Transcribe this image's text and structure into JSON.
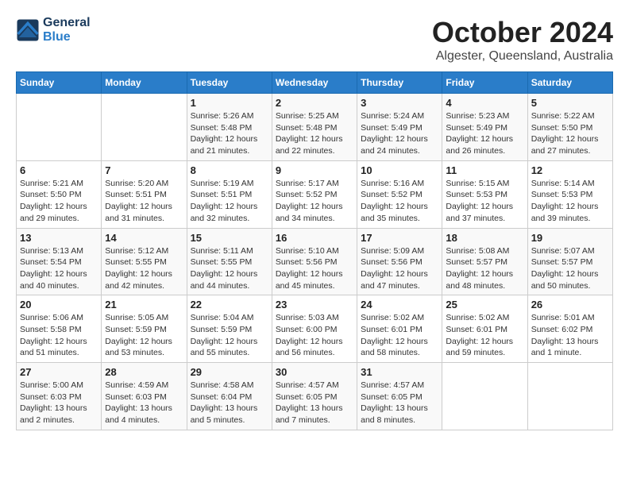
{
  "header": {
    "logo_line1": "General",
    "logo_line2": "Blue",
    "month": "October 2024",
    "location": "Algester, Queensland, Australia"
  },
  "days_of_week": [
    "Sunday",
    "Monday",
    "Tuesday",
    "Wednesday",
    "Thursday",
    "Friday",
    "Saturday"
  ],
  "weeks": [
    [
      {
        "day": "",
        "info": ""
      },
      {
        "day": "",
        "info": ""
      },
      {
        "day": "1",
        "info": "Sunrise: 5:26 AM\nSunset: 5:48 PM\nDaylight: 12 hours\nand 21 minutes."
      },
      {
        "day": "2",
        "info": "Sunrise: 5:25 AM\nSunset: 5:48 PM\nDaylight: 12 hours\nand 22 minutes."
      },
      {
        "day": "3",
        "info": "Sunrise: 5:24 AM\nSunset: 5:49 PM\nDaylight: 12 hours\nand 24 minutes."
      },
      {
        "day": "4",
        "info": "Sunrise: 5:23 AM\nSunset: 5:49 PM\nDaylight: 12 hours\nand 26 minutes."
      },
      {
        "day": "5",
        "info": "Sunrise: 5:22 AM\nSunset: 5:50 PM\nDaylight: 12 hours\nand 27 minutes."
      }
    ],
    [
      {
        "day": "6",
        "info": "Sunrise: 5:21 AM\nSunset: 5:50 PM\nDaylight: 12 hours\nand 29 minutes."
      },
      {
        "day": "7",
        "info": "Sunrise: 5:20 AM\nSunset: 5:51 PM\nDaylight: 12 hours\nand 31 minutes."
      },
      {
        "day": "8",
        "info": "Sunrise: 5:19 AM\nSunset: 5:51 PM\nDaylight: 12 hours\nand 32 minutes."
      },
      {
        "day": "9",
        "info": "Sunrise: 5:17 AM\nSunset: 5:52 PM\nDaylight: 12 hours\nand 34 minutes."
      },
      {
        "day": "10",
        "info": "Sunrise: 5:16 AM\nSunset: 5:52 PM\nDaylight: 12 hours\nand 35 minutes."
      },
      {
        "day": "11",
        "info": "Sunrise: 5:15 AM\nSunset: 5:53 PM\nDaylight: 12 hours\nand 37 minutes."
      },
      {
        "day": "12",
        "info": "Sunrise: 5:14 AM\nSunset: 5:53 PM\nDaylight: 12 hours\nand 39 minutes."
      }
    ],
    [
      {
        "day": "13",
        "info": "Sunrise: 5:13 AM\nSunset: 5:54 PM\nDaylight: 12 hours\nand 40 minutes."
      },
      {
        "day": "14",
        "info": "Sunrise: 5:12 AM\nSunset: 5:55 PM\nDaylight: 12 hours\nand 42 minutes."
      },
      {
        "day": "15",
        "info": "Sunrise: 5:11 AM\nSunset: 5:55 PM\nDaylight: 12 hours\nand 44 minutes."
      },
      {
        "day": "16",
        "info": "Sunrise: 5:10 AM\nSunset: 5:56 PM\nDaylight: 12 hours\nand 45 minutes."
      },
      {
        "day": "17",
        "info": "Sunrise: 5:09 AM\nSunset: 5:56 PM\nDaylight: 12 hours\nand 47 minutes."
      },
      {
        "day": "18",
        "info": "Sunrise: 5:08 AM\nSunset: 5:57 PM\nDaylight: 12 hours\nand 48 minutes."
      },
      {
        "day": "19",
        "info": "Sunrise: 5:07 AM\nSunset: 5:57 PM\nDaylight: 12 hours\nand 50 minutes."
      }
    ],
    [
      {
        "day": "20",
        "info": "Sunrise: 5:06 AM\nSunset: 5:58 PM\nDaylight: 12 hours\nand 51 minutes."
      },
      {
        "day": "21",
        "info": "Sunrise: 5:05 AM\nSunset: 5:59 PM\nDaylight: 12 hours\nand 53 minutes."
      },
      {
        "day": "22",
        "info": "Sunrise: 5:04 AM\nSunset: 5:59 PM\nDaylight: 12 hours\nand 55 minutes."
      },
      {
        "day": "23",
        "info": "Sunrise: 5:03 AM\nSunset: 6:00 PM\nDaylight: 12 hours\nand 56 minutes."
      },
      {
        "day": "24",
        "info": "Sunrise: 5:02 AM\nSunset: 6:01 PM\nDaylight: 12 hours\nand 58 minutes."
      },
      {
        "day": "25",
        "info": "Sunrise: 5:02 AM\nSunset: 6:01 PM\nDaylight: 12 hours\nand 59 minutes."
      },
      {
        "day": "26",
        "info": "Sunrise: 5:01 AM\nSunset: 6:02 PM\nDaylight: 13 hours\nand 1 minute."
      }
    ],
    [
      {
        "day": "27",
        "info": "Sunrise: 5:00 AM\nSunset: 6:03 PM\nDaylight: 13 hours\nand 2 minutes."
      },
      {
        "day": "28",
        "info": "Sunrise: 4:59 AM\nSunset: 6:03 PM\nDaylight: 13 hours\nand 4 minutes."
      },
      {
        "day": "29",
        "info": "Sunrise: 4:58 AM\nSunset: 6:04 PM\nDaylight: 13 hours\nand 5 minutes."
      },
      {
        "day": "30",
        "info": "Sunrise: 4:57 AM\nSunset: 6:05 PM\nDaylight: 13 hours\nand 7 minutes."
      },
      {
        "day": "31",
        "info": "Sunrise: 4:57 AM\nSunset: 6:05 PM\nDaylight: 13 hours\nand 8 minutes."
      },
      {
        "day": "",
        "info": ""
      },
      {
        "day": "",
        "info": ""
      }
    ]
  ]
}
